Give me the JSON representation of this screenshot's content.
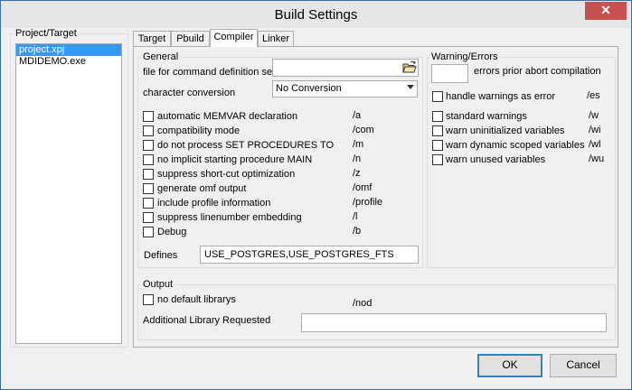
{
  "window": {
    "title": "Build Settings",
    "close_glyph": "✕"
  },
  "project_target": {
    "legend": "Project/Target",
    "items": [
      {
        "label": "project.xpj",
        "selected": true
      },
      {
        "label": "MDIDEMO.exe",
        "selected": false
      }
    ]
  },
  "tabs": [
    {
      "label": "Target",
      "active": false
    },
    {
      "label": "Pbuild",
      "active": false
    },
    {
      "label": "Compiler",
      "active": true
    },
    {
      "label": "Linker",
      "active": false
    }
  ],
  "general": {
    "legend": "General",
    "command_file_label": "file for command definition set",
    "command_file_value": "",
    "char_conv_label": "character conversion",
    "char_conv_value": "No Conversion",
    "options": [
      {
        "label": "automatic MEMVAR declaration",
        "switch": "/a",
        "checked": false
      },
      {
        "label": "compatibility mode",
        "switch": "/com",
        "checked": false
      },
      {
        "label": "do not process SET PROCEDURES TO",
        "switch": "/m",
        "checked": false
      },
      {
        "label": "no implicit starting procedure MAIN",
        "switch": "/n",
        "checked": false
      },
      {
        "label": "suppress short-cut optimization",
        "switch": "/z",
        "checked": false
      },
      {
        "label": "generate omf output",
        "switch": "/omf",
        "checked": false
      },
      {
        "label": "include profile information",
        "switch": "/profile",
        "checked": false
      },
      {
        "label": "suppress linenumber embedding",
        "switch": "/l",
        "checked": false
      },
      {
        "label": "Debug",
        "switch": "/b",
        "checked": false
      }
    ],
    "defines_label": "Defines",
    "defines_value": "USE_POSTGRES,USE_POSTGRES_FTS"
  },
  "warnings": {
    "legend": "Warning/Errors",
    "errors_prior_value": "",
    "errors_prior_label": "errors prior abort compilation",
    "handle_label": "handle warnings as error",
    "handle_switch": "/es",
    "options": [
      {
        "label": "standard warnings",
        "switch": "/w",
        "checked": false
      },
      {
        "label": "warn uninitialized variables",
        "switch": "/wi",
        "checked": false
      },
      {
        "label": "warn dynamic scoped variables",
        "switch": "/wl",
        "checked": false
      },
      {
        "label": "warn unused variables",
        "switch": "/wu",
        "checked": false
      }
    ]
  },
  "output": {
    "legend": "Output",
    "nodefault_label": "no default librarys",
    "nodefault_switch": "/nod",
    "additional_label": "Additional Library Requested",
    "additional_value": ""
  },
  "buttons": {
    "ok": "OK",
    "cancel": "Cancel"
  }
}
